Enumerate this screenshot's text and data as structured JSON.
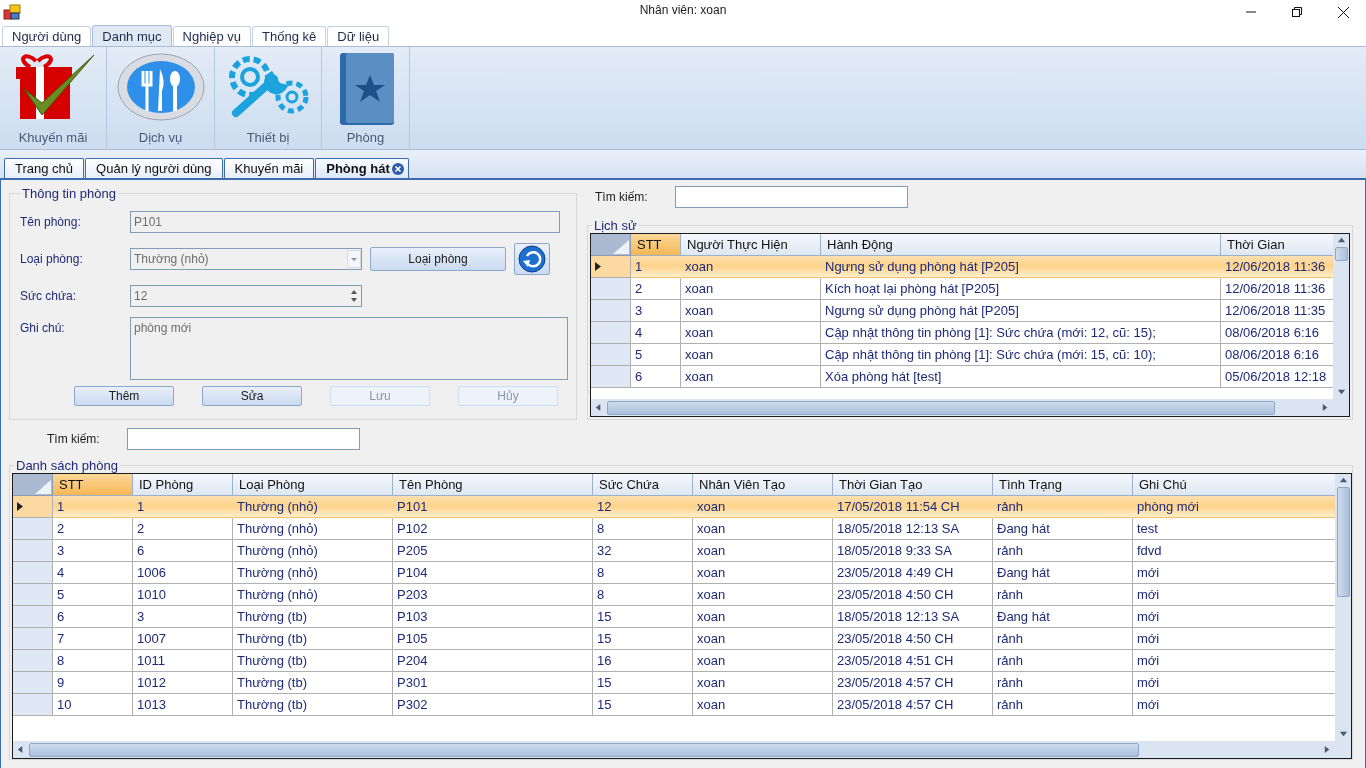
{
  "window": {
    "title": "Nhân viên: xoan"
  },
  "menu_tabs": [
    {
      "label": "Người dùng",
      "selected": false
    },
    {
      "label": "Danh mục",
      "selected": true
    },
    {
      "label": "Nghiệp vụ",
      "selected": false
    },
    {
      "label": "Thống kê",
      "selected": false
    },
    {
      "label": "Dữ liệu",
      "selected": false
    }
  ],
  "ribbon": [
    {
      "label": "Khuyến mãi",
      "kind": "gift"
    },
    {
      "label": "Dịch vụ",
      "kind": "cutlery"
    },
    {
      "label": "Thiết bị",
      "kind": "tools"
    },
    {
      "label": "Phòng",
      "kind": "book"
    }
  ],
  "doc_tabs": [
    {
      "label": "Trang chủ",
      "selected": false,
      "closable": false
    },
    {
      "label": "Quản lý người dùng",
      "selected": false,
      "closable": false
    },
    {
      "label": "Khuyến mãi",
      "selected": false,
      "closable": false
    },
    {
      "label": "Phòng hát",
      "selected": true,
      "closable": true
    }
  ],
  "room_info": {
    "title": "Thông tin phòng",
    "name_label": "Tên phòng:",
    "name_value": "P101",
    "type_label": "Loại  phòng:",
    "type_value": "Thường (nhỏ)",
    "type_button": "Loại phòng",
    "capacity_label": "Sức chứa:",
    "capacity_value": "12",
    "note_label": "Ghi chú:",
    "note_value": "phòng mới",
    "buttons": [
      {
        "label": "Thêm",
        "disabled": false
      },
      {
        "label": "Sửa",
        "disabled": false
      },
      {
        "label": "Lưu",
        "disabled": true
      },
      {
        "label": "Hủy",
        "disabled": true
      }
    ]
  },
  "history_search": {
    "label": "Tìm kiếm:"
  },
  "history": {
    "title": "Lịch sử",
    "columns": [
      "STT",
      "Người Thực Hiện",
      "Hành Động",
      "Thời Gian"
    ],
    "rows": [
      {
        "selected": true,
        "cells": [
          "1",
          "xoan",
          "Ngưng sử dụng phòng hát [P205]",
          "12/06/2018 11:36"
        ]
      },
      {
        "selected": false,
        "cells": [
          "2",
          "xoan",
          "Kích hoạt lại phòng hát [P205]",
          "12/06/2018 11:36"
        ]
      },
      {
        "selected": false,
        "cells": [
          "3",
          "xoan",
          "Ngưng sử dụng phòng hát [P205]",
          "12/06/2018 11:35"
        ]
      },
      {
        "selected": false,
        "cells": [
          "4",
          "xoan",
          "Cập nhật thông tin phòng [1]: Sức chứa (mới: 12, cũ: 15);",
          "08/06/2018 6:16"
        ]
      },
      {
        "selected": false,
        "cells": [
          "5",
          "xoan",
          "Cập nhật thông tin phòng [1]: Sức chứa (mới: 15, cũ: 10);",
          "08/06/2018 6:16"
        ]
      },
      {
        "selected": false,
        "cells": [
          "6",
          "xoan",
          "Xóa phòng hát [test]",
          "05/06/2018 12:18"
        ]
      }
    ]
  },
  "room_search": {
    "label": "Tìm kiếm:"
  },
  "rooms": {
    "title": "Danh sách phòng",
    "columns": [
      "STT",
      "ID Phòng",
      "Loại Phòng",
      "Tên Phòng",
      "Sức Chứa",
      "Nhân Viên Tạo",
      "Thời Gian Tạo",
      "Tình Trạng",
      "Ghi Chú"
    ],
    "rows": [
      {
        "selected": true,
        "cells": [
          "1",
          "1",
          "Thường (nhỏ)",
          "P101",
          "12",
          "xoan",
          "17/05/2018 11:54 CH",
          "rảnh",
          "phòng mới"
        ]
      },
      {
        "selected": false,
        "cells": [
          "2",
          "2",
          "Thường (nhỏ)",
          "P102",
          "8",
          "xoan",
          "18/05/2018 12:13 SA",
          "Đang hát",
          "test"
        ]
      },
      {
        "selected": false,
        "cells": [
          "3",
          "6",
          "Thường (nhỏ)",
          "P205",
          "32",
          "xoan",
          "18/05/2018 9:33 SA",
          "rảnh",
          "fdvd"
        ]
      },
      {
        "selected": false,
        "cells": [
          "4",
          "1006",
          "Thường (nhỏ)",
          "P104",
          "8",
          "xoan",
          "23/05/2018 4:49 CH",
          "Đang hát",
          "mới"
        ]
      },
      {
        "selected": false,
        "cells": [
          "5",
          "1010",
          "Thường (nhỏ)",
          "P203",
          "8",
          "xoan",
          "23/05/2018 4:50 CH",
          "rảnh",
          "mới"
        ]
      },
      {
        "selected": false,
        "cells": [
          "6",
          "3",
          "Thường (tb)",
          "P103",
          "15",
          "xoan",
          "18/05/2018 12:13 SA",
          "Đang hát",
          "mới"
        ]
      },
      {
        "selected": false,
        "cells": [
          "7",
          "1007",
          "Thường (tb)",
          "P105",
          "15",
          "xoan",
          "23/05/2018 4:50 CH",
          "rảnh",
          "mới"
        ]
      },
      {
        "selected": false,
        "cells": [
          "8",
          "1011",
          "Thường (tb)",
          "P204",
          "16",
          "xoan",
          "23/05/2018 4:51 CH",
          "rảnh",
          "mới"
        ]
      },
      {
        "selected": false,
        "cells": [
          "9",
          "1012",
          "Thường (tb)",
          "P301",
          "15",
          "xoan",
          "23/05/2018 4:57 CH",
          "rảnh",
          "mới"
        ]
      },
      {
        "selected": false,
        "cells": [
          "10",
          "1013",
          "Thường (tb)",
          "P302",
          "15",
          "xoan",
          "23/05/2018 4:57 CH",
          "rảnh",
          "mới"
        ]
      }
    ]
  }
}
